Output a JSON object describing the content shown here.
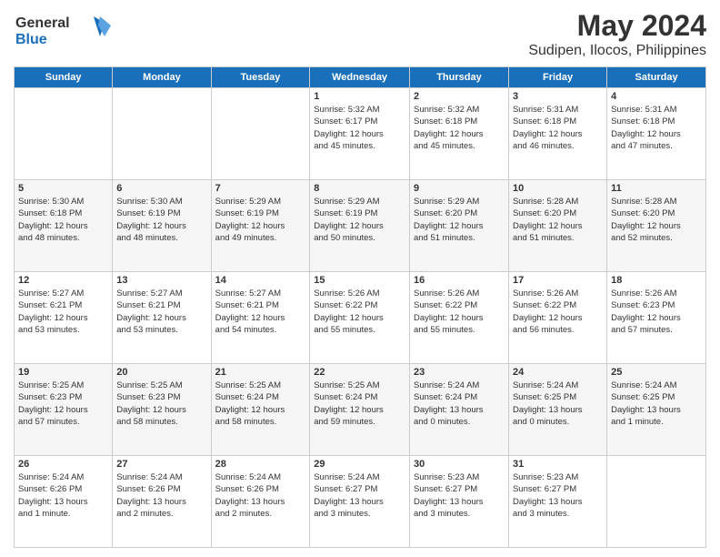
{
  "logo": {
    "line1": "General",
    "line2": "Blue"
  },
  "title": "May 2024",
  "subtitle": "Sudipen, Ilocos, Philippines",
  "headers": [
    "Sunday",
    "Monday",
    "Tuesday",
    "Wednesday",
    "Thursday",
    "Friday",
    "Saturday"
  ],
  "weeks": [
    [
      {
        "day": "",
        "info": ""
      },
      {
        "day": "",
        "info": ""
      },
      {
        "day": "",
        "info": ""
      },
      {
        "day": "1",
        "info": "Sunrise: 5:32 AM\nSunset: 6:17 PM\nDaylight: 12 hours\nand 45 minutes."
      },
      {
        "day": "2",
        "info": "Sunrise: 5:32 AM\nSunset: 6:18 PM\nDaylight: 12 hours\nand 45 minutes."
      },
      {
        "day": "3",
        "info": "Sunrise: 5:31 AM\nSunset: 6:18 PM\nDaylight: 12 hours\nand 46 minutes."
      },
      {
        "day": "4",
        "info": "Sunrise: 5:31 AM\nSunset: 6:18 PM\nDaylight: 12 hours\nand 47 minutes."
      }
    ],
    [
      {
        "day": "5",
        "info": "Sunrise: 5:30 AM\nSunset: 6:18 PM\nDaylight: 12 hours\nand 48 minutes."
      },
      {
        "day": "6",
        "info": "Sunrise: 5:30 AM\nSunset: 6:19 PM\nDaylight: 12 hours\nand 48 minutes."
      },
      {
        "day": "7",
        "info": "Sunrise: 5:29 AM\nSunset: 6:19 PM\nDaylight: 12 hours\nand 49 minutes."
      },
      {
        "day": "8",
        "info": "Sunrise: 5:29 AM\nSunset: 6:19 PM\nDaylight: 12 hours\nand 50 minutes."
      },
      {
        "day": "9",
        "info": "Sunrise: 5:29 AM\nSunset: 6:20 PM\nDaylight: 12 hours\nand 51 minutes."
      },
      {
        "day": "10",
        "info": "Sunrise: 5:28 AM\nSunset: 6:20 PM\nDaylight: 12 hours\nand 51 minutes."
      },
      {
        "day": "11",
        "info": "Sunrise: 5:28 AM\nSunset: 6:20 PM\nDaylight: 12 hours\nand 52 minutes."
      }
    ],
    [
      {
        "day": "12",
        "info": "Sunrise: 5:27 AM\nSunset: 6:21 PM\nDaylight: 12 hours\nand 53 minutes."
      },
      {
        "day": "13",
        "info": "Sunrise: 5:27 AM\nSunset: 6:21 PM\nDaylight: 12 hours\nand 53 minutes."
      },
      {
        "day": "14",
        "info": "Sunrise: 5:27 AM\nSunset: 6:21 PM\nDaylight: 12 hours\nand 54 minutes."
      },
      {
        "day": "15",
        "info": "Sunrise: 5:26 AM\nSunset: 6:22 PM\nDaylight: 12 hours\nand 55 minutes."
      },
      {
        "day": "16",
        "info": "Sunrise: 5:26 AM\nSunset: 6:22 PM\nDaylight: 12 hours\nand 55 minutes."
      },
      {
        "day": "17",
        "info": "Sunrise: 5:26 AM\nSunset: 6:22 PM\nDaylight: 12 hours\nand 56 minutes."
      },
      {
        "day": "18",
        "info": "Sunrise: 5:26 AM\nSunset: 6:23 PM\nDaylight: 12 hours\nand 57 minutes."
      }
    ],
    [
      {
        "day": "19",
        "info": "Sunrise: 5:25 AM\nSunset: 6:23 PM\nDaylight: 12 hours\nand 57 minutes."
      },
      {
        "day": "20",
        "info": "Sunrise: 5:25 AM\nSunset: 6:23 PM\nDaylight: 12 hours\nand 58 minutes."
      },
      {
        "day": "21",
        "info": "Sunrise: 5:25 AM\nSunset: 6:24 PM\nDaylight: 12 hours\nand 58 minutes."
      },
      {
        "day": "22",
        "info": "Sunrise: 5:25 AM\nSunset: 6:24 PM\nDaylight: 12 hours\nand 59 minutes."
      },
      {
        "day": "23",
        "info": "Sunrise: 5:24 AM\nSunset: 6:24 PM\nDaylight: 13 hours\nand 0 minutes."
      },
      {
        "day": "24",
        "info": "Sunrise: 5:24 AM\nSunset: 6:25 PM\nDaylight: 13 hours\nand 0 minutes."
      },
      {
        "day": "25",
        "info": "Sunrise: 5:24 AM\nSunset: 6:25 PM\nDaylight: 13 hours\nand 1 minute."
      }
    ],
    [
      {
        "day": "26",
        "info": "Sunrise: 5:24 AM\nSunset: 6:26 PM\nDaylight: 13 hours\nand 1 minute."
      },
      {
        "day": "27",
        "info": "Sunrise: 5:24 AM\nSunset: 6:26 PM\nDaylight: 13 hours\nand 2 minutes."
      },
      {
        "day": "28",
        "info": "Sunrise: 5:24 AM\nSunset: 6:26 PM\nDaylight: 13 hours\nand 2 minutes."
      },
      {
        "day": "29",
        "info": "Sunrise: 5:24 AM\nSunset: 6:27 PM\nDaylight: 13 hours\nand 3 minutes."
      },
      {
        "day": "30",
        "info": "Sunrise: 5:23 AM\nSunset: 6:27 PM\nDaylight: 13 hours\nand 3 minutes."
      },
      {
        "day": "31",
        "info": "Sunrise: 5:23 AM\nSunset: 6:27 PM\nDaylight: 13 hours\nand 3 minutes."
      },
      {
        "day": "",
        "info": ""
      }
    ]
  ]
}
